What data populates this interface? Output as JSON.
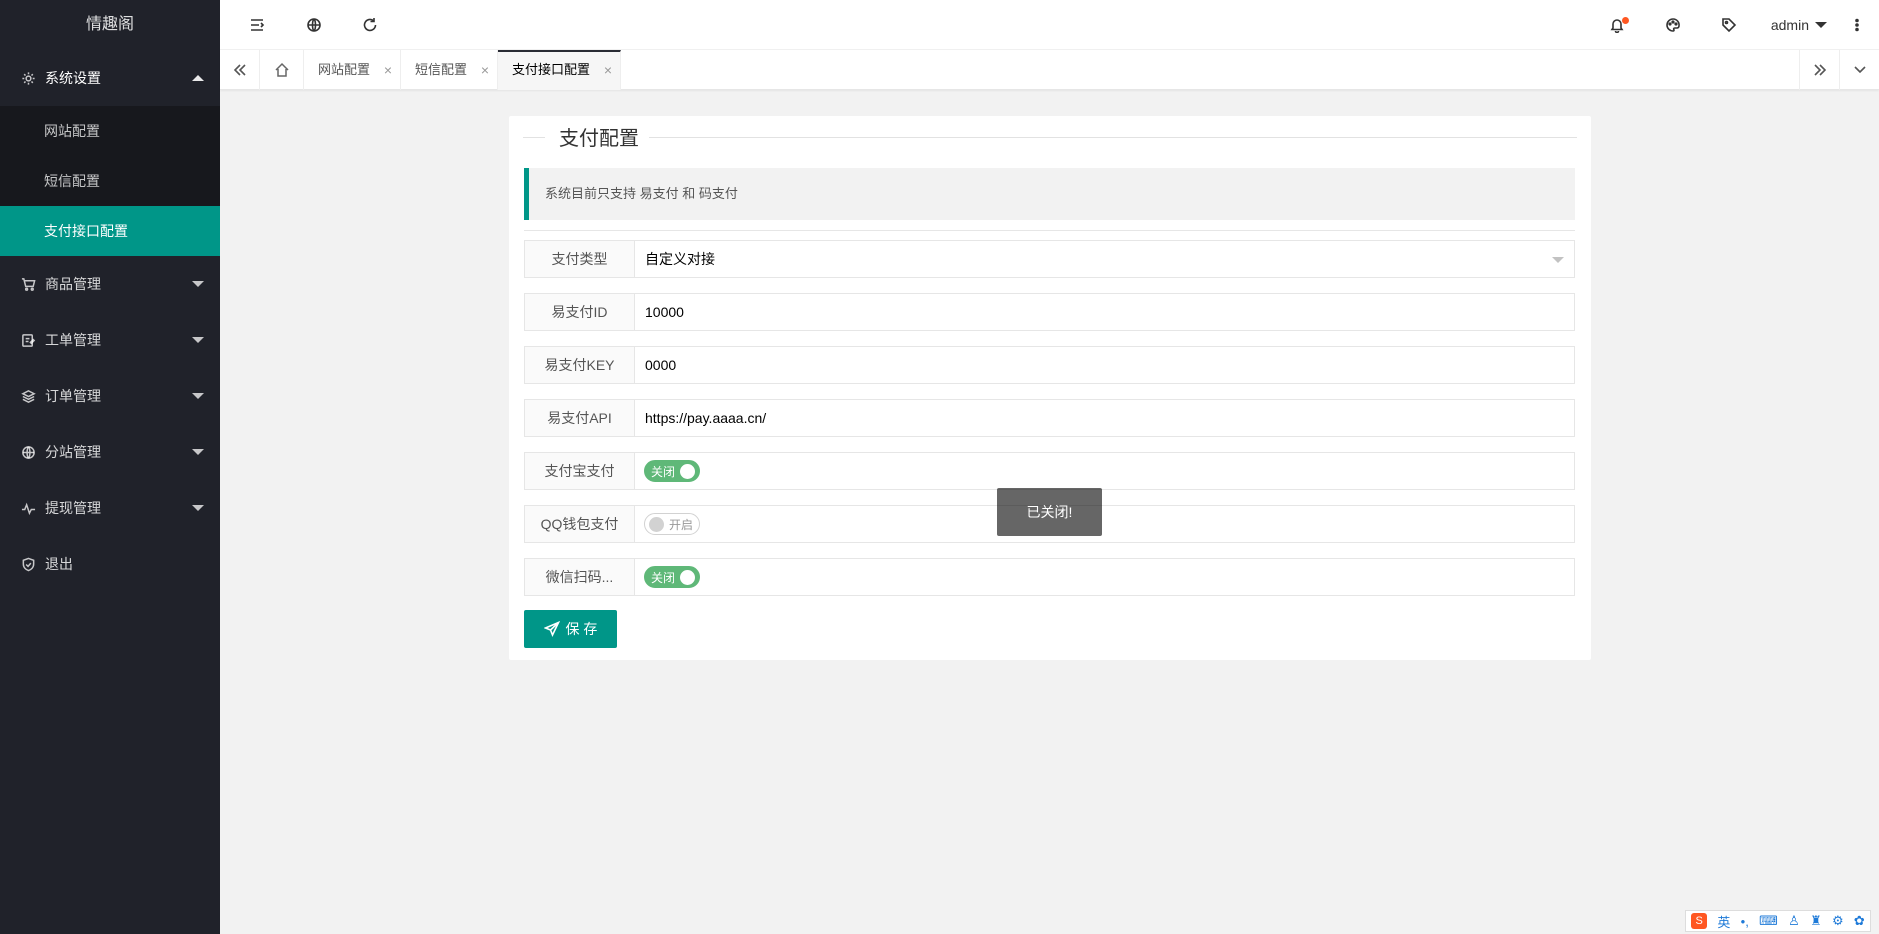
{
  "app": {
    "title": "情趣阁"
  },
  "sidebar": {
    "items": [
      {
        "label": "系统设置",
        "icon": "gear-icon",
        "expanded": true,
        "children": [
          {
            "label": "网站配置",
            "active": false
          },
          {
            "label": "短信配置",
            "active": false
          },
          {
            "label": "支付接口配置",
            "active": true
          }
        ]
      },
      {
        "label": "商品管理",
        "icon": "cart-icon"
      },
      {
        "label": "工单管理",
        "icon": "ticket-icon"
      },
      {
        "label": "订单管理",
        "icon": "layers-icon"
      },
      {
        "label": "分站管理",
        "icon": "globe-icon"
      },
      {
        "label": "提现管理",
        "icon": "pulse-icon"
      },
      {
        "label": "退出",
        "icon": "shield-check-icon"
      }
    ]
  },
  "header": {
    "user": "admin"
  },
  "tabs": [
    {
      "label": "网站配置",
      "close": "×"
    },
    {
      "label": "短信配置",
      "close": "×"
    },
    {
      "label": "支付接口配置",
      "close": "×",
      "active": true
    }
  ],
  "main": {
    "section_title": "支付配置",
    "notice": "系统目前只支持 易支付 和 码支付",
    "fields": {
      "pay_type": {
        "label": "支付类型",
        "value": "自定义对接"
      },
      "epay_id": {
        "label": "易支付ID",
        "value": "10000"
      },
      "epay_key": {
        "label": "易支付KEY",
        "value": "0000"
      },
      "epay_api": {
        "label": "易支付API",
        "value": "https://pay.aaaa.cn/"
      },
      "alipay": {
        "label": "支付宝支付",
        "switch_text": "关闭",
        "on": true
      },
      "qqpay": {
        "label": "QQ钱包支付",
        "switch_text": "开启",
        "on": false
      },
      "wxpay": {
        "label": "微信扫码...",
        "switch_text": "关闭",
        "on": true
      }
    },
    "save_label": "保 存"
  },
  "toast": {
    "text": "已关闭!"
  },
  "ime": {
    "lang": "英",
    "punct": "•,"
  },
  "colors": {
    "sidebar_bg": "#20222a",
    "accent": "#009688",
    "switch_on": "#5fb878",
    "notify_dot": "#ff5722"
  }
}
